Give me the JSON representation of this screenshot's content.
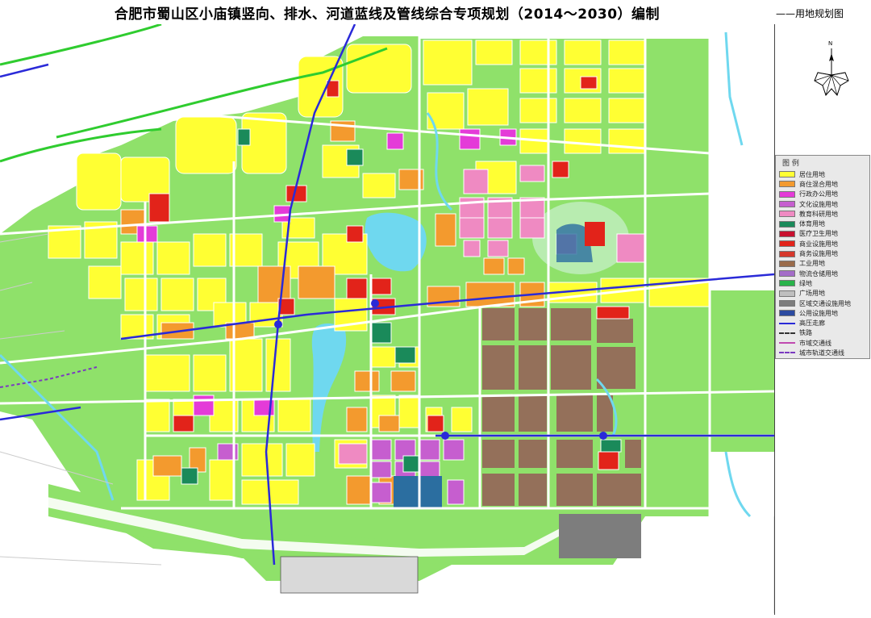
{
  "header": {
    "title": "合肥市蜀山区小庙镇竖向、排水、河道蓝线及管线综合专项规划（2014～2030）编制",
    "subtitle": "——用地规划图"
  },
  "compass": {
    "north": "N"
  },
  "legend": {
    "heading": "图  例",
    "items": [
      {
        "label": "居住用地",
        "color": "#ffff33",
        "kind": "fill"
      },
      {
        "label": "商住混合用地",
        "color": "#f39a2e",
        "kind": "fill"
      },
      {
        "label": "行政办公用地",
        "color": "#e43bd8",
        "kind": "fill"
      },
      {
        "label": "文化设施用地",
        "color": "#c65ecf",
        "kind": "fill"
      },
      {
        "label": "教育科研用地",
        "color": "#ef8ac2",
        "kind": "fill"
      },
      {
        "label": "体育用地",
        "color": "#1a8a5a",
        "kind": "fill"
      },
      {
        "label": "医疗卫生用地",
        "color": "#c8102e",
        "kind": "fill"
      },
      {
        "label": "商业设施用地",
        "color": "#e2231a",
        "kind": "fill"
      },
      {
        "label": "商务设施用地",
        "color": "#d6372b",
        "kind": "fill"
      },
      {
        "label": "工业用地",
        "color": "#9a6b4a",
        "kind": "fill"
      },
      {
        "label": "物流仓储用地",
        "color": "#a46dc8",
        "kind": "fill"
      },
      {
        "label": "绿地",
        "color": "#29b34a",
        "kind": "fill"
      },
      {
        "label": "广场用地",
        "color": "#bfbfbf",
        "kind": "fill"
      },
      {
        "label": "区域交通设施用地",
        "color": "#7d7d7d",
        "kind": "fill"
      },
      {
        "label": "公用设施用地",
        "color": "#2b4aa0",
        "kind": "fill"
      },
      {
        "label": "高压走廊",
        "color": "#2a2ad8",
        "kind": "line"
      },
      {
        "label": "铁路",
        "color": "#333333",
        "kind": "dash"
      },
      {
        "label": "市域交通线",
        "color": "#c04ab0",
        "kind": "line"
      },
      {
        "label": "城市轨道交通线",
        "color": "#7a3ac0",
        "kind": "dash"
      }
    ]
  },
  "colors": {
    "residential": "#ffff33",
    "mixed": "#f39a2e",
    "admin": "#e43bd8",
    "education": "#ef8ac2",
    "sports": "#1a8a5a",
    "commercial": "#e2231a",
    "industrial": "#94705a",
    "green": "#8fe16a",
    "water": "#6fd8ef",
    "road": "#ffffff",
    "utility": "#2b4aa0",
    "traffic": "#7d7d7d"
  }
}
